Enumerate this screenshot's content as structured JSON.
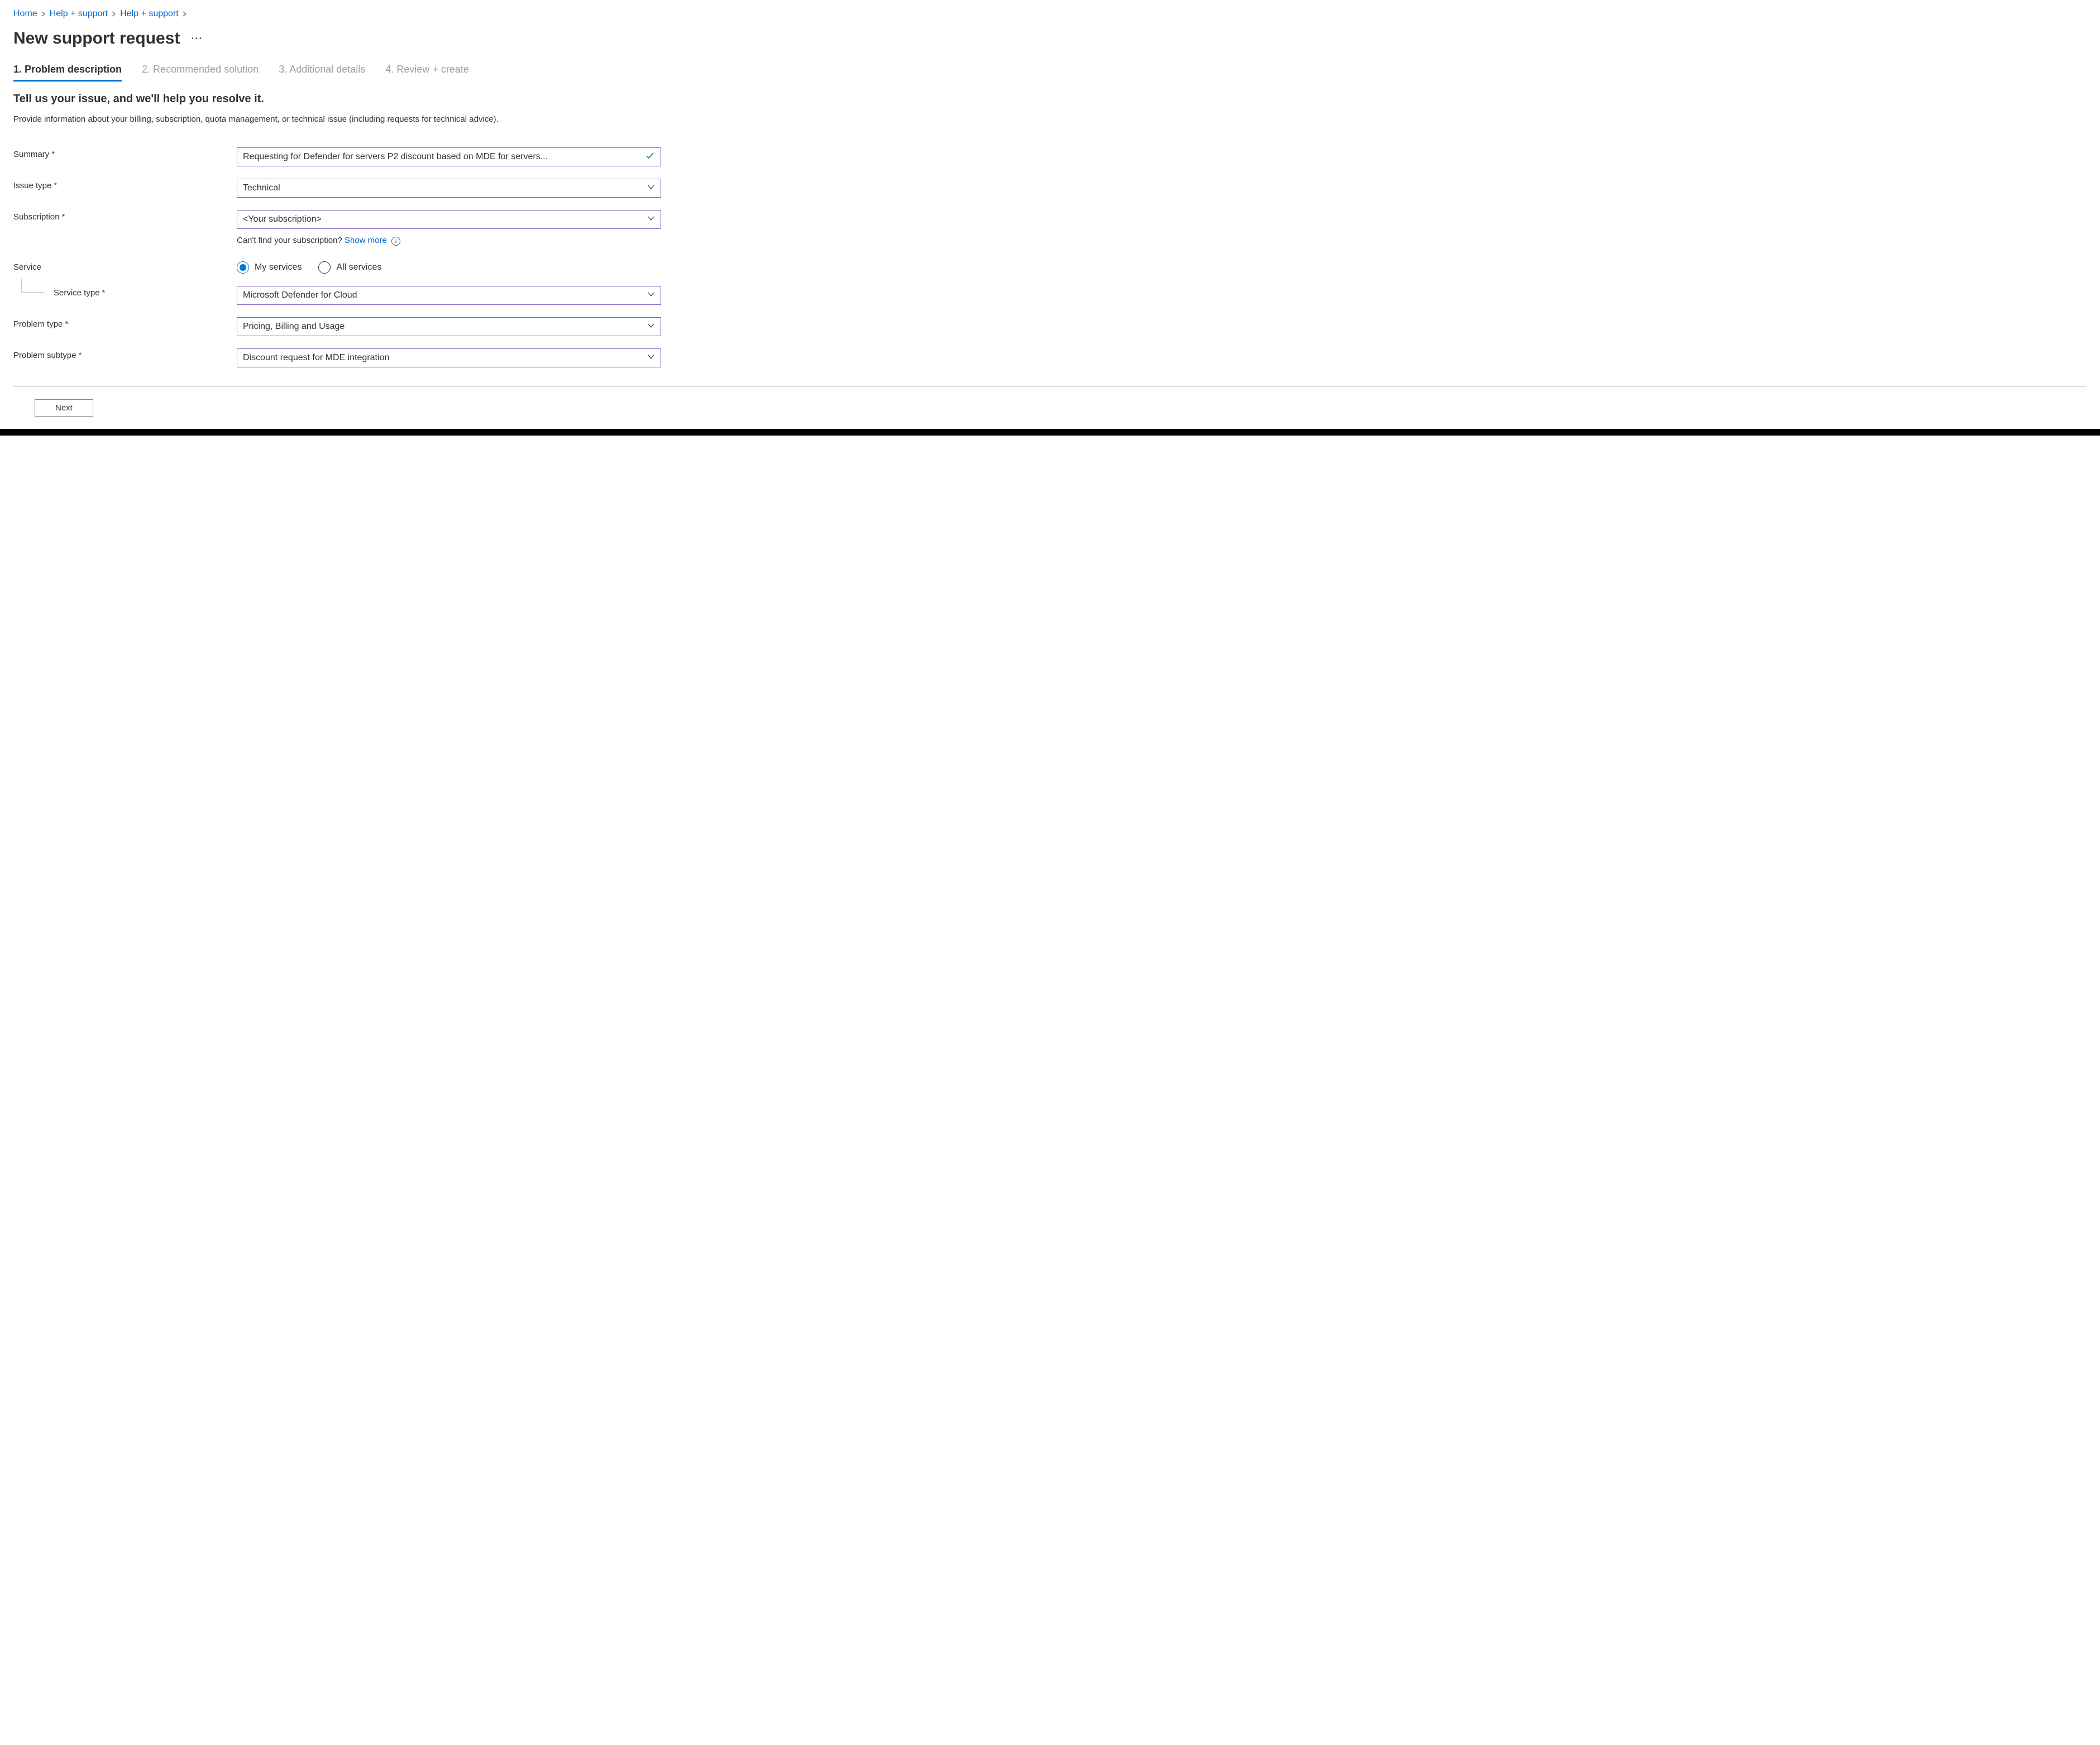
{
  "breadcrumb": {
    "items": [
      "Home",
      "Help + support",
      "Help + support"
    ]
  },
  "page": {
    "title": "New support request",
    "ellipsis": "···"
  },
  "tabs": [
    {
      "label": "1. Problem description",
      "active": true
    },
    {
      "label": "2. Recommended solution",
      "active": false
    },
    {
      "label": "3. Additional details",
      "active": false
    },
    {
      "label": "4. Review + create",
      "active": false
    }
  ],
  "section": {
    "title": "Tell us your issue, and we'll help you resolve it.",
    "desc": "Provide information about your billing, subscription, quota management, or technical issue (including requests for technical advice)."
  },
  "fields": {
    "summary": {
      "label": "Summary",
      "value": "Requesting for Defender for servers P2 discount based on MDE for servers..."
    },
    "issue_type": {
      "label": "Issue type",
      "value": "Technical"
    },
    "subscription": {
      "label": "Subscription",
      "value": "<Your subscription>",
      "helper_prefix": "Can't find your subscription? ",
      "helper_link": "Show more"
    },
    "service": {
      "label": "Service",
      "options": {
        "my": "My services",
        "all": "All services"
      },
      "selected": "my"
    },
    "service_type": {
      "label": "Service type",
      "value": "Microsoft Defender for Cloud"
    },
    "problem_type": {
      "label": "Problem type",
      "value": "Pricing, Billing and Usage"
    },
    "problem_subtype": {
      "label": "Problem subtype",
      "value": "Discount request for MDE integration"
    }
  },
  "required_mark": "*",
  "footer": {
    "next": "Next"
  }
}
